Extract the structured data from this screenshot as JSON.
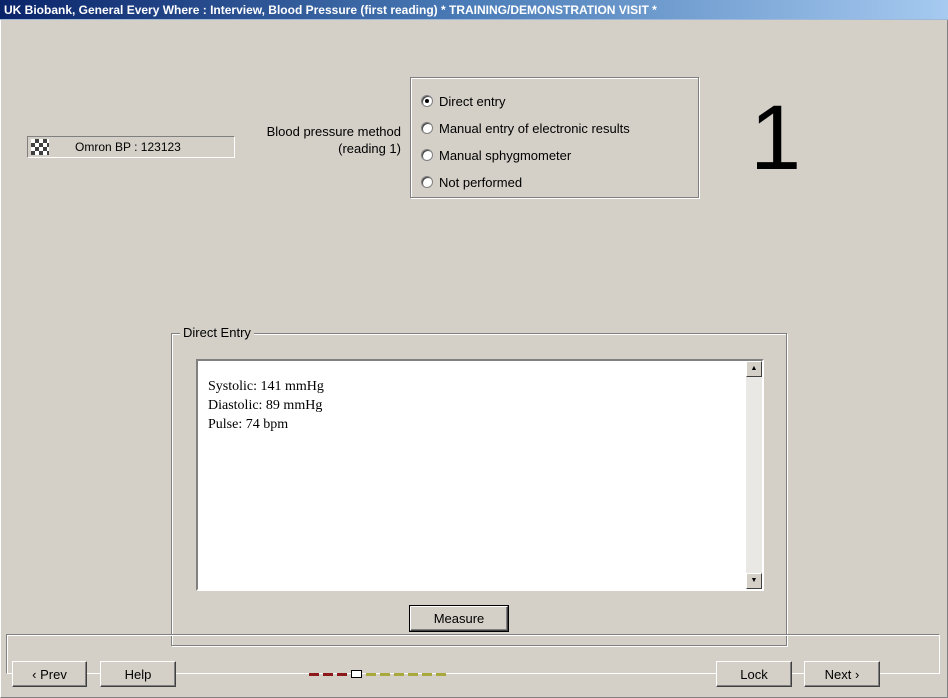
{
  "window": {
    "title": "UK Biobank, General Every Where : Interview, Blood Pressure (first reading) * TRAINING/DEMONSTRATION VISIT *"
  },
  "device": {
    "label": "Omron BP : 123123",
    "icon": "checkered-device-icon"
  },
  "method": {
    "label_line1": "Blood pressure method",
    "label_line2": "(reading 1)",
    "options": [
      {
        "label": "Direct entry",
        "checked": true
      },
      {
        "label": "Manual entry of electronic results",
        "checked": false
      },
      {
        "label": "Manual sphygmometer",
        "checked": false
      },
      {
        "label": "Not performed",
        "checked": false
      }
    ]
  },
  "reading_number": "1",
  "direct_entry": {
    "legend": "Direct Entry",
    "lines": [
      "Systolic: 141 mmHg",
      "Diastolic: 89 mmHg",
      "Pulse: 74 bpm"
    ],
    "measure_label": "Measure"
  },
  "footer": {
    "prev_label": "‹ Prev",
    "help_label": "Help",
    "lock_label": "Lock",
    "next_label": "Next ›",
    "progress": {
      "completed": 3,
      "current": 4,
      "total": 10,
      "completed_color": "#8b1a1a",
      "remaining_color": "#a8a83c"
    }
  }
}
